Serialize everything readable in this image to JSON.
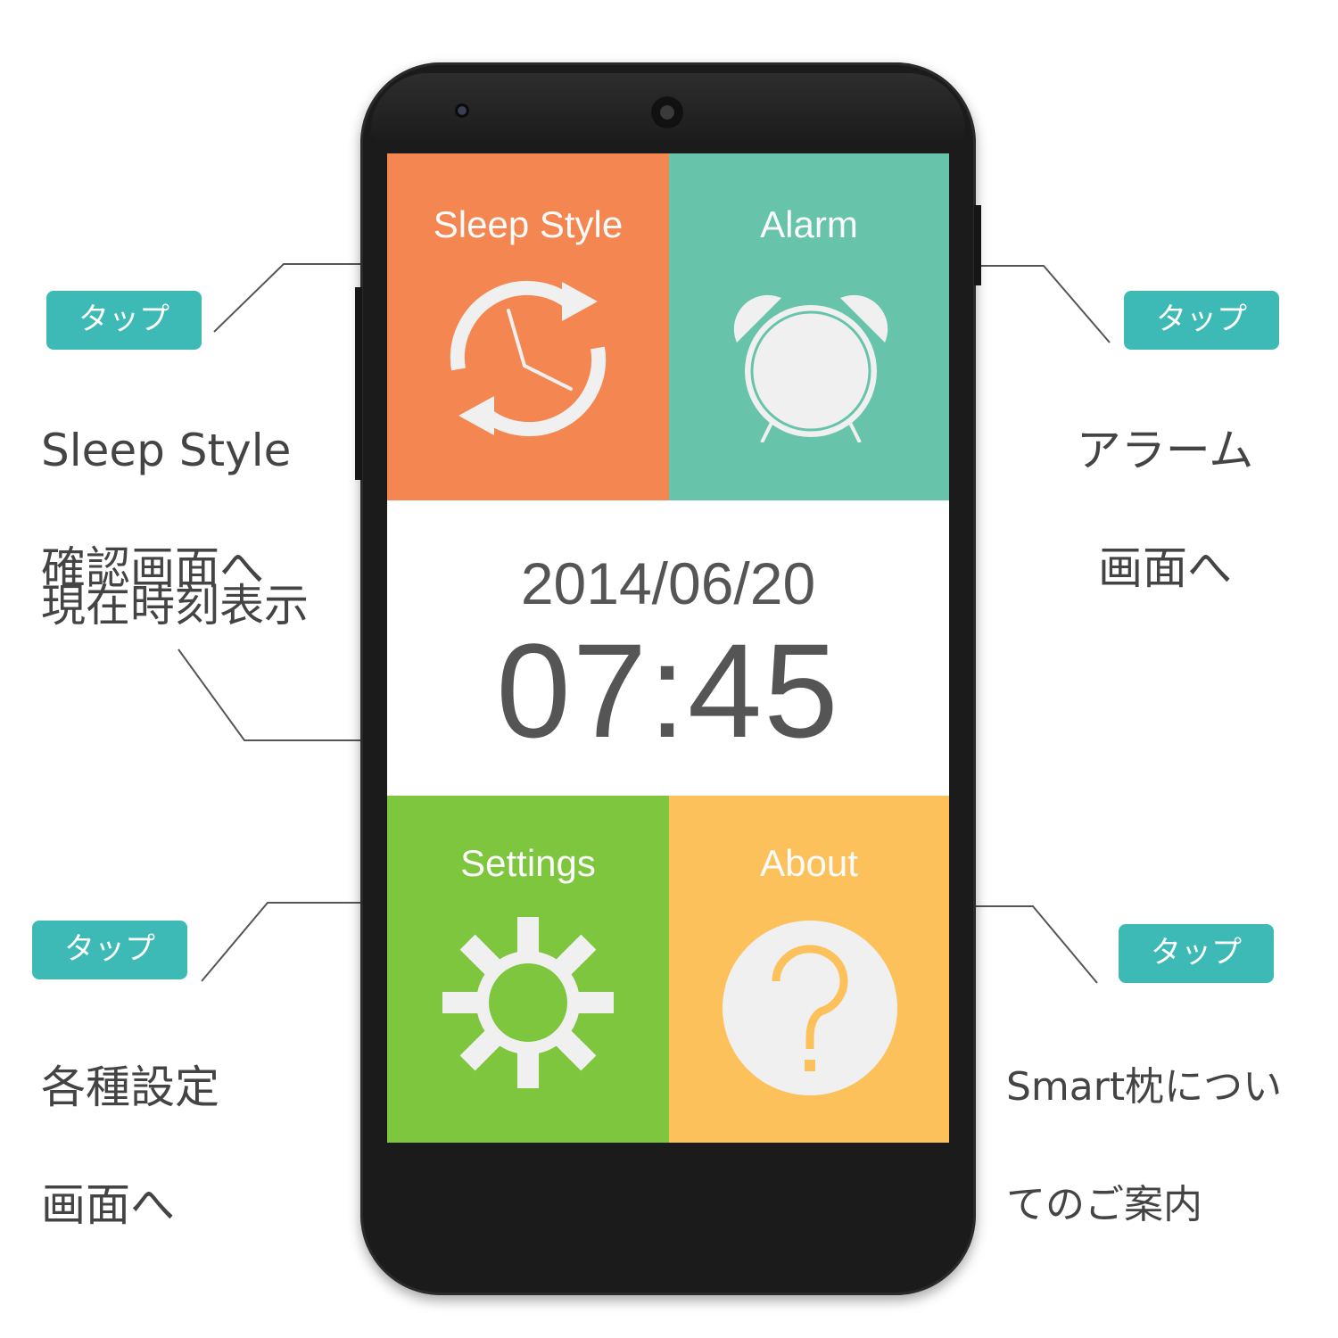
{
  "tiles": {
    "sleep_style": {
      "label": "Sleep Style",
      "color": "#f48751",
      "icon": "refresh-clock-icon"
    },
    "alarm": {
      "label": "Alarm",
      "color": "#67c4aa",
      "icon": "alarm-clock-icon"
    },
    "settings": {
      "label": "Settings",
      "color": "#7fc63f",
      "icon": "gear-icon"
    },
    "about": {
      "label": "About",
      "color": "#fcc15a",
      "icon": "question-icon"
    }
  },
  "clock": {
    "date": "2014/06/20",
    "time": "07:45"
  },
  "annotations": {
    "sleep_style": {
      "badge": "タップ",
      "line1": "Sleep Style",
      "line2": "確認画面へ"
    },
    "alarm": {
      "badge": "タップ",
      "line1": "アラーム",
      "line2": "画面へ"
    },
    "clock": {
      "text": "現在時刻表示"
    },
    "settings": {
      "badge": "タップ",
      "line1": "各種設定",
      "line2": "画面へ"
    },
    "about": {
      "badge": "タップ",
      "line1": "Smart枕につい",
      "line2": "てのご案内"
    }
  },
  "colors": {
    "badge": "#3dbab6",
    "icon_fill": "#f0f0f0",
    "text_dark": "#555555"
  }
}
